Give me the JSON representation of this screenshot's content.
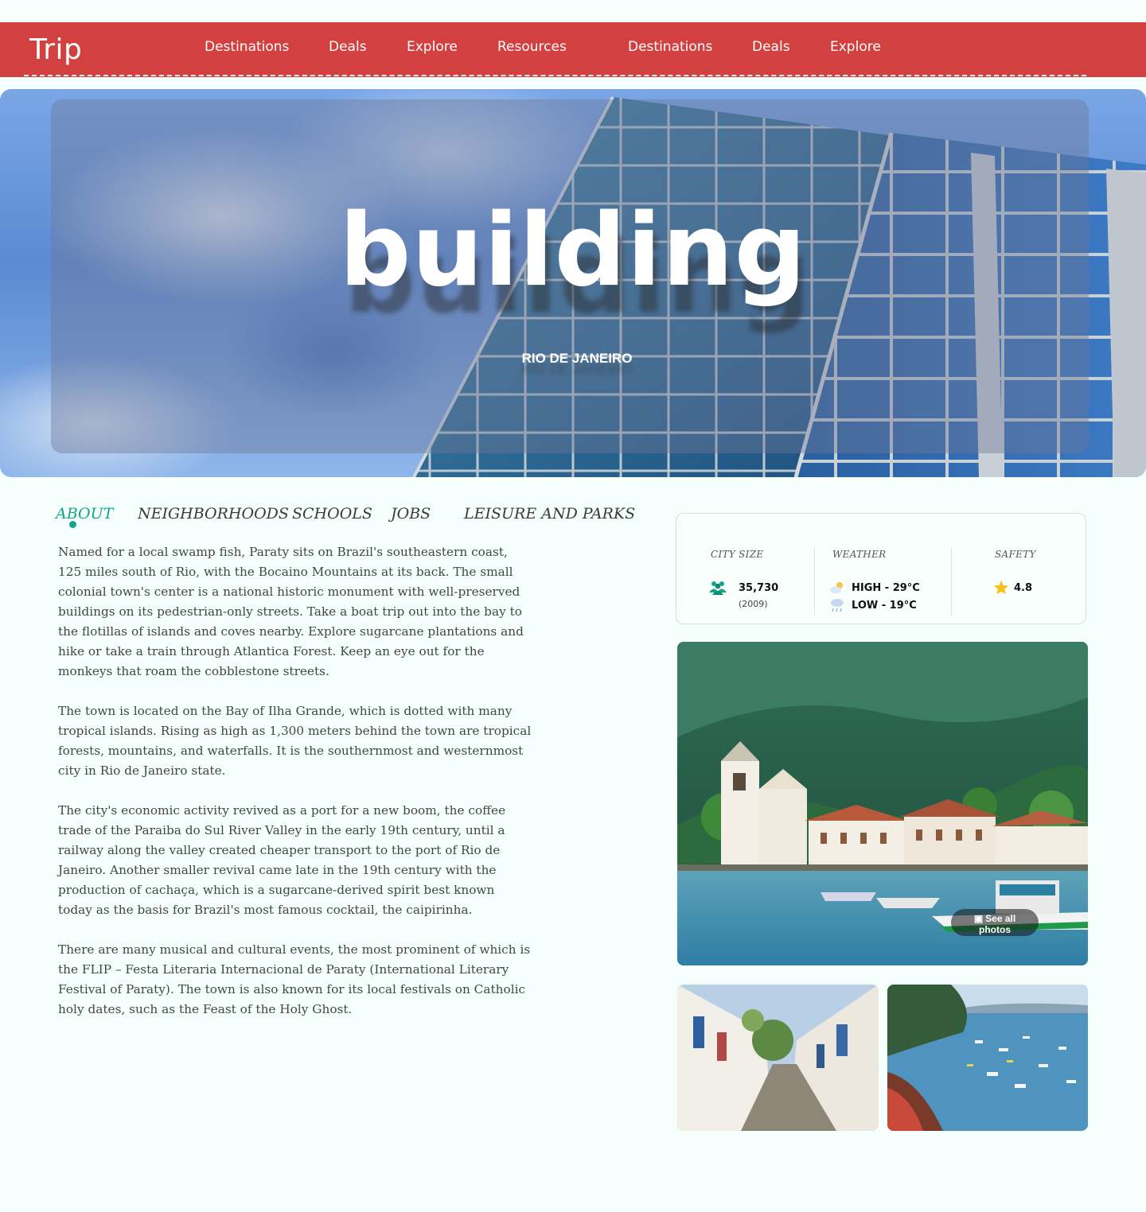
{
  "nav": {
    "logo": "Trip",
    "links": [
      "Destinations",
      "Deals",
      "Explore",
      "Resources",
      "Destinations",
      "Deals",
      "Explore"
    ]
  },
  "hero": {
    "title": "building",
    "subtitle": "RIO DE JANEIRO"
  },
  "tabs": [
    {
      "label": "ABOUT",
      "active": true
    },
    {
      "label": "NEIGHBORHOODS",
      "active": false
    },
    {
      "label": "SCHOOLS",
      "active": false
    },
    {
      "label": "JOBS",
      "active": false
    },
    {
      "label": "LEISURE AND PARKS",
      "active": false
    }
  ],
  "article": {
    "paragraphs": [
      "Named for a local swamp fish, Paraty sits on Brazil's southeastern coast, 125 miles south of Rio, with the Bocaino Mountains at its back. The small colonial town's center is a national historic monument with well-preserved buildings on its pedestrian-only streets. Take a boat trip out into the bay to the flotillas of islands and coves nearby. Explore sugarcane plantations and hike or take a train through Atlantica Forest. Keep an eye out for the monkeys that roam the cobblestone streets.",
      "The town is located on the Bay of Ilha Grande, which is dotted with many tropical islands. Rising as high as 1,300 meters behind the town are tropical forests, mountains, and waterfalls. It is the southernmost and westernmost city in Rio de Janeiro state.",
      "The city's economic activity revived as a port for a new boom, the coffee trade of the Paraiba do Sul River Valley in the early 19th century, until a railway along the valley created cheaper transport to the port of Rio de Janeiro. Another smaller revival came late in the 19th century with the production of cachaça, which is a sugarcane-derived spirit best known today as the basis for Brazil's most famous cocktail, the caipirinha.",
      "There are many musical and cultural events, the most prominent of which is the FLIP – Festa Literaria Internacional de Paraty (International Literary Festival of Paraty). The town is also known for its local festivals on Catholic holy dates, such as the Feast of the Holy Ghost."
    ]
  },
  "stats": {
    "city_size": {
      "label": "CITY SIZE",
      "value": "35,730",
      "year": "(2009)",
      "icon": "people-icon"
    },
    "weather": {
      "label": "WEATHER",
      "high": "HIGH - 29°C",
      "low": "LOW - 19°C",
      "icons": [
        "sun-cloud-icon",
        "rain-cloud-icon"
      ]
    },
    "safety": {
      "label": "SAFETY",
      "value": "4.8",
      "icon": "star-icon"
    }
  },
  "gallery": {
    "see_all_line1": "See all",
    "see_all_line2": "photos"
  },
  "colors": {
    "nav_bg": "#d34040",
    "accent": "#17a38a",
    "page_bg": "#f5fffc"
  }
}
